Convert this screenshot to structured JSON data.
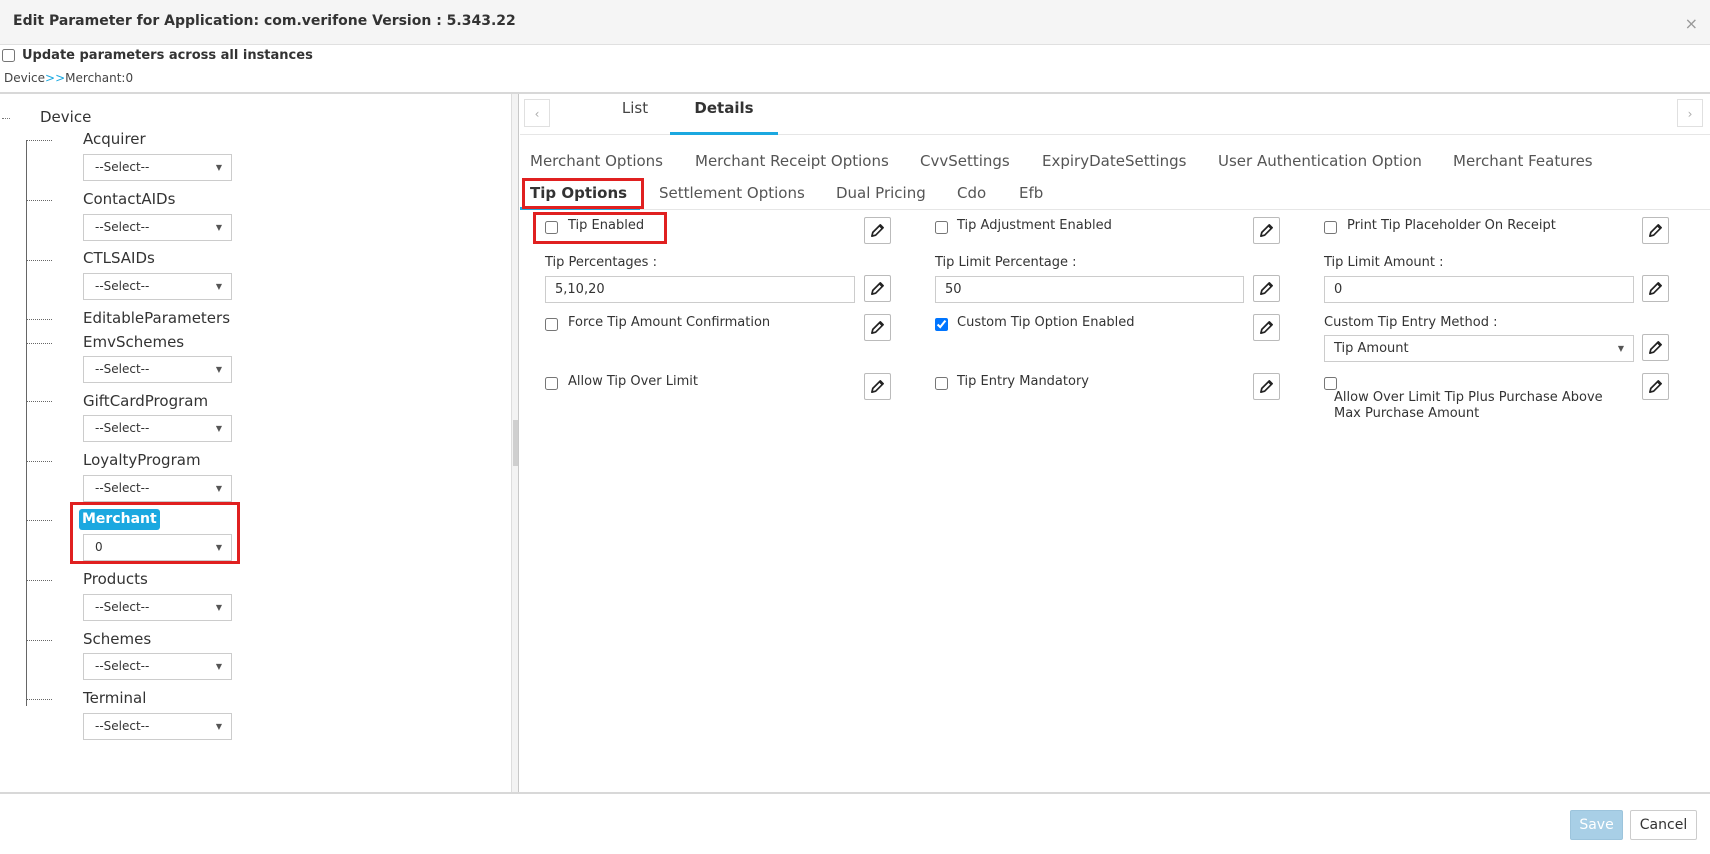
{
  "dialog": {
    "title": "Edit Parameter for Application: com.verifone Version : 5.343.22",
    "close_glyph": "×",
    "update_label": "Update parameters across all instances",
    "update_checked": false
  },
  "breadcrumb": {
    "root": "Device",
    "separator": ">>",
    "current": "Merchant:0"
  },
  "tree": {
    "root": "Device",
    "nodes": [
      {
        "label": "Acquirer",
        "value": "--Select--"
      },
      {
        "label": "ContactAIDs",
        "value": "--Select--"
      },
      {
        "label": "CTLSAIDs",
        "value": "--Select--"
      },
      {
        "label": "EditableParameters"
      },
      {
        "label": "EmvSchemes",
        "value": "--Select--"
      },
      {
        "label": "GiftCardProgram",
        "value": "--Select--"
      },
      {
        "label": "LoyaltyProgram",
        "value": "--Select--"
      },
      {
        "label": "Merchant",
        "value": "0",
        "selected": true
      },
      {
        "label": "Products",
        "value": "--Select--"
      },
      {
        "label": "Schemes",
        "value": "--Select--"
      },
      {
        "label": "Terminal",
        "value": "--Select--"
      }
    ]
  },
  "view_tabs": {
    "prev": "‹",
    "next": "›",
    "list": "List",
    "details": "Details",
    "active": "Details"
  },
  "subtabs": {
    "row1": [
      "Merchant Options",
      "Merchant Receipt Options",
      "CvvSettings",
      "ExpiryDateSettings",
      "User Authentication Option",
      "Merchant Features"
    ],
    "row2": [
      "Tip Options",
      "Settlement Options",
      "Dual Pricing",
      "Cdo",
      "Efb"
    ],
    "active": "Tip Options"
  },
  "tip_options": {
    "tip_enabled": {
      "label": "Tip Enabled",
      "checked": false
    },
    "tip_adjustment_enabled": {
      "label": "Tip Adjustment Enabled",
      "checked": false
    },
    "print_tip_placeholder": {
      "label": "Print Tip Placeholder On Receipt",
      "checked": false
    },
    "tip_percentages": {
      "label": "Tip Percentages :",
      "value": "5,10,20"
    },
    "tip_limit_percentage": {
      "label": "Tip Limit Percentage :",
      "value": "50"
    },
    "tip_limit_amount": {
      "label": "Tip Limit Amount :",
      "value": "0"
    },
    "force_tip_confirmation": {
      "label": "Force Tip Amount Confirmation",
      "checked": false
    },
    "custom_tip_option_enabled": {
      "label": "Custom Tip Option Enabled",
      "checked": true
    },
    "custom_tip_entry_method": {
      "label": "Custom Tip Entry Method :",
      "value": "Tip Amount"
    },
    "allow_tip_over_limit": {
      "label": "Allow Tip Over Limit",
      "checked": false
    },
    "tip_entry_mandatory": {
      "label": "Tip Entry Mandatory",
      "checked": false
    },
    "allow_over_limit_tip_plus_purchase": {
      "label": "Allow Over Limit Tip Plus Purchase Above Max Purchase Amount",
      "checked": false
    }
  },
  "footer": {
    "save": "Save",
    "cancel": "Cancel"
  },
  "colors": {
    "accent": "#1ba8e0",
    "highlight_box": "#e02020",
    "save_disabled": "#a8cfe6"
  }
}
